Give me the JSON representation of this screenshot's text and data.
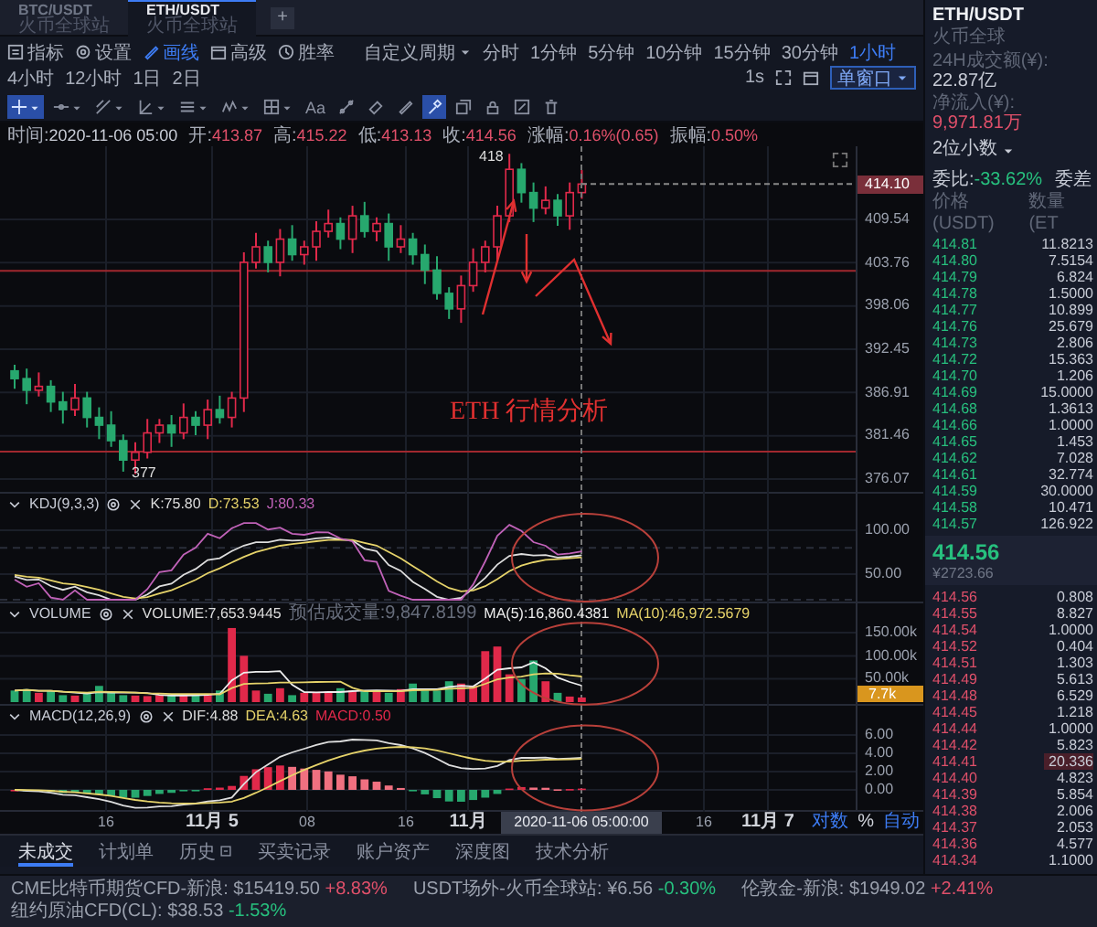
{
  "symbol_tabs": [
    {
      "symbol": "BTC/USDT",
      "exchange": "火币全球站",
      "selected": false
    },
    {
      "symbol": "ETH/USDT",
      "exchange": "火币全球站",
      "selected": true
    }
  ],
  "add_tab": "+",
  "toolbar": {
    "tools": [
      {
        "label": "指标",
        "selected": false
      },
      {
        "label": "设置",
        "selected": false
      },
      {
        "label": "画线",
        "selected": true
      },
      {
        "label": "高级",
        "selected": false
      },
      {
        "label": "胜率",
        "selected": false
      }
    ],
    "custom_period": "自定义周期",
    "periods": [
      {
        "label": "分时",
        "selected": false
      },
      {
        "label": "1分钟",
        "selected": false
      },
      {
        "label": "5分钟",
        "selected": false
      },
      {
        "label": "10分钟",
        "selected": false
      },
      {
        "label": "15分钟",
        "selected": false
      },
      {
        "label": "30分钟",
        "selected": false
      },
      {
        "label": "1小时",
        "selected": true
      },
      {
        "label": "4小时",
        "selected": false
      },
      {
        "label": "12小时",
        "selected": false
      },
      {
        "label": "1日",
        "selected": false
      },
      {
        "label": "2日",
        "selected": false
      }
    ],
    "refresh_rate": "1s",
    "window_mode": "单窗口"
  },
  "draw_tools": [
    {
      "selected": true
    },
    {
      "selected": false
    },
    {
      "selected": false
    },
    {
      "selected": false
    },
    {
      "selected": false
    },
    {
      "selected": false
    },
    {
      "selected": false
    },
    {
      "label": "Aa",
      "selected": false
    },
    {
      "selected": false
    },
    {
      "selected": false
    },
    {
      "selected": false
    },
    {
      "selected": true
    },
    {
      "selected": false
    },
    {
      "selected": false
    },
    {
      "selected": false
    },
    {
      "selected": false
    }
  ],
  "info_bar": [
    {
      "label": "时间:",
      "value": "2020-11-06 05:00",
      "kind": "time"
    },
    {
      "label": "开:",
      "value": "413.87",
      "kind": "price"
    },
    {
      "label": "高:",
      "value": "415.22",
      "kind": "price"
    },
    {
      "label": "低:",
      "value": "413.13",
      "kind": "price"
    },
    {
      "label": "收:",
      "value": "414.56",
      "kind": "price"
    },
    {
      "label": "涨幅:",
      "value": "0.16%(0.65)",
      "kind": "price"
    },
    {
      "label": "振幅:",
      "value": "0.50%",
      "kind": "price"
    }
  ],
  "main_chart": {
    "price_ticks": [
      "409.54",
      "403.76",
      "398.06",
      "392.45",
      "386.91",
      "381.46",
      "376.07"
    ],
    "current_price": "414.10",
    "high_mark": "418",
    "low_mark": "377",
    "annotation": "ETH 行情分析"
  },
  "kdj": {
    "name": "KDJ(9,3,3)",
    "values": [
      {
        "text": "K:75.80",
        "color": "#dddddd"
      },
      {
        "text": "D:73.53",
        "color": "#e6d36a"
      },
      {
        "text": "J:80.33",
        "color": "#c062b8"
      }
    ],
    "ticks": [
      "100.00",
      "50.00"
    ]
  },
  "volume": {
    "name": "VOLUME",
    "values": [
      {
        "text": "VOLUME:7,653.9445",
        "color": "#dddddd"
      },
      {
        "text": "预估成交量:9,847.8199",
        "color": "#666c7a"
      },
      {
        "text": "MA(5):16,860.4381",
        "color": "#eeeeee"
      },
      {
        "text": "MA(10):46,972.5679",
        "color": "#e6d36a"
      }
    ],
    "ticks": [
      "150.00k",
      "100.00k",
      "50.00k"
    ],
    "current": "7.7k"
  },
  "macd": {
    "name": "MACD(12,26,9)",
    "values": [
      {
        "text": "DIF:4.88",
        "color": "#dddddd"
      },
      {
        "text": "DEA:4.63",
        "color": "#e6d36a"
      },
      {
        "text": "MACD:0.50",
        "color": "#e0294a"
      }
    ],
    "ticks": [
      "6.00",
      "4.00",
      "2.00",
      "0.00"
    ]
  },
  "time_axis": {
    "labels": [
      "16",
      "11月 5",
      "08",
      "16",
      "11月",
      "16",
      "11月 7"
    ],
    "crosshair": "2020-11-06 05:00:00",
    "scale_options": [
      {
        "label": "对数",
        "selected": true
      },
      {
        "label": "%",
        "selected": false
      },
      {
        "label": "自动",
        "selected": true
      }
    ]
  },
  "bottom_tabs": [
    {
      "label": "未成交",
      "selected": true
    },
    {
      "label": "计划单",
      "selected": false
    },
    {
      "label": "历史",
      "selected": false
    },
    {
      "label": "买卖记录",
      "selected": false
    },
    {
      "label": "账户资产",
      "selected": false
    },
    {
      "label": "深度图",
      "selected": false
    },
    {
      "label": "技术分析",
      "selected": false
    }
  ],
  "order_book": {
    "title": "ETH/USDT",
    "exchange": "火币全球",
    "turnover_label": "24H成交额(¥):",
    "turnover": "22.87亿",
    "inflow_label": "净流入(¥):",
    "inflow": "9,971.81万",
    "decimals": "2位小数",
    "ratio_label": "委比:",
    "ratio": "-33.62%",
    "diff_label": "委差",
    "columns": [
      "价格(USDT)",
      "数量(ET"
    ],
    "asks": [
      {
        "price": "414.81",
        "amount": "11.8213",
        "highlighted": false
      },
      {
        "price": "414.80",
        "amount": "7.5154",
        "highlighted": false
      },
      {
        "price": "414.79",
        "amount": "6.824",
        "highlighted": false
      },
      {
        "price": "414.78",
        "amount": "1.5000",
        "highlighted": false
      },
      {
        "price": "414.77",
        "amount": "10.899",
        "highlighted": false
      },
      {
        "price": "414.76",
        "amount": "25.679",
        "highlighted": false
      },
      {
        "price": "414.73",
        "amount": "2.806",
        "highlighted": false
      },
      {
        "price": "414.72",
        "amount": "15.363",
        "highlighted": false
      },
      {
        "price": "414.70",
        "amount": "1.206",
        "highlighted": false
      },
      {
        "price": "414.69",
        "amount": "15.0000",
        "highlighted": false
      },
      {
        "price": "414.68",
        "amount": "1.3613",
        "highlighted": false
      },
      {
        "price": "414.66",
        "amount": "1.0000",
        "highlighted": false
      },
      {
        "price": "414.65",
        "amount": "1.453",
        "highlighted": false
      },
      {
        "price": "414.62",
        "amount": "7.028",
        "highlighted": false
      },
      {
        "price": "414.61",
        "amount": "32.774",
        "highlighted": false
      },
      {
        "price": "414.59",
        "amount": "30.0000",
        "highlighted": false
      },
      {
        "price": "414.58",
        "amount": "10.471",
        "highlighted": false
      },
      {
        "price": "414.57",
        "amount": "126.922",
        "highlighted": false
      }
    ],
    "last_price": "414.56",
    "last_price_cny": "¥2723.66",
    "bids": [
      {
        "price": "414.56",
        "amount": "0.808",
        "highlighted": false
      },
      {
        "price": "414.55",
        "amount": "8.827",
        "highlighted": false
      },
      {
        "price": "414.54",
        "amount": "1.0000",
        "highlighted": false
      },
      {
        "price": "414.52",
        "amount": "0.404",
        "highlighted": false
      },
      {
        "price": "414.51",
        "amount": "1.303",
        "highlighted": false
      },
      {
        "price": "414.49",
        "amount": "5.613",
        "highlighted": false
      },
      {
        "price": "414.48",
        "amount": "6.529",
        "highlighted": false
      },
      {
        "price": "414.45",
        "amount": "1.218",
        "highlighted": false
      },
      {
        "price": "414.44",
        "amount": "1.0000",
        "highlighted": false
      },
      {
        "price": "414.42",
        "amount": "5.823",
        "highlighted": false
      },
      {
        "price": "414.41",
        "amount": "20.336",
        "highlighted": true
      },
      {
        "price": "414.40",
        "amount": "4.823",
        "highlighted": false
      },
      {
        "price": "414.39",
        "amount": "5.854",
        "highlighted": false
      },
      {
        "price": "414.38",
        "amount": "2.006",
        "highlighted": false
      },
      {
        "price": "414.37",
        "amount": "2.053",
        "highlighted": false
      },
      {
        "price": "414.36",
        "amount": "4.577",
        "highlighted": false
      },
      {
        "price": "414.34",
        "amount": "1.1000",
        "highlighted": false
      }
    ]
  },
  "ticker": [
    {
      "name": "CME比特币期货CFD-新浪:",
      "price": "$15419.50",
      "change": "+8.83%",
      "color": "#e0506a"
    },
    {
      "name": "USDT场外-火币全球站:",
      "price": "¥6.56",
      "change": "-0.30%",
      "color": "#27c07e"
    },
    {
      "name": "伦敦金-新浪:",
      "price": "$1949.02",
      "change": "+2.41%",
      "color": "#e0506a"
    },
    {
      "name": "纽约原油CFD(CL):",
      "price": "$38.53",
      "change": "-1.53%",
      "color": "#27c07e"
    }
  ]
}
